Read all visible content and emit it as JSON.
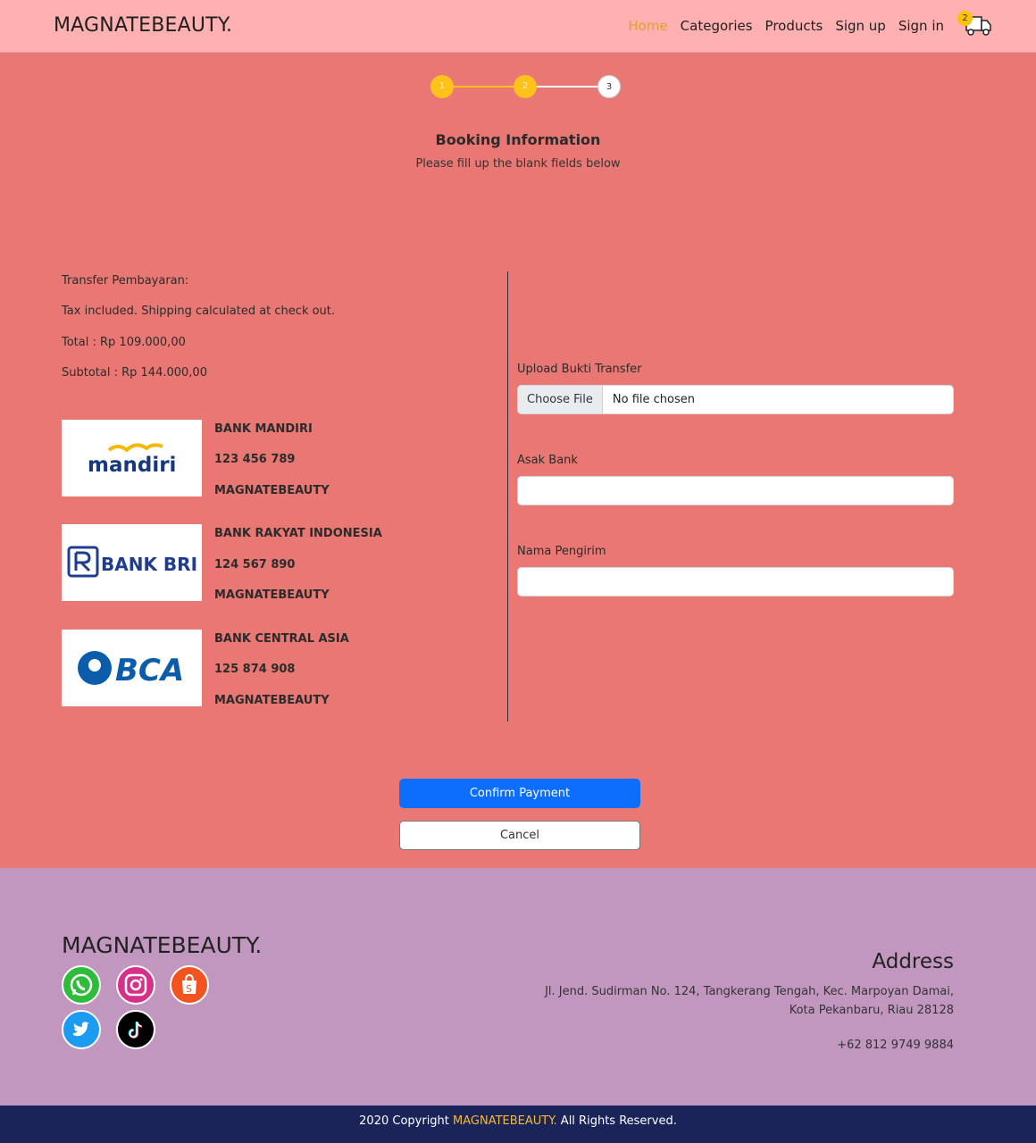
{
  "nav": {
    "brand": "MAGNATEBEAUTY.",
    "links": [
      "Home",
      "Categories",
      "Products",
      "Sign up",
      "Sign in"
    ],
    "cart_count": "2",
    "active_color": "#e3a02e"
  },
  "stepper": {
    "steps": [
      "1",
      "2",
      "3"
    ],
    "active_color": "#ffc21a"
  },
  "heading": {
    "title": "Booking Information",
    "subtitle": "Please fill up the blank fields below"
  },
  "payment": {
    "transfer_label": "Transfer Pembayaran:",
    "tax_note": "Tax included. Shipping calculated at check out.",
    "total": "Total : Rp 109.000,00",
    "subtotal": "Subtotal : Rp 144.000,00"
  },
  "banks": [
    {
      "logo_text": "mandiri",
      "name": "BANK MANDIRI",
      "account": "123 456 789",
      "holder": "MAGNATEBEAUTY"
    },
    {
      "logo_text": "BANK BRI",
      "name": "BANK RAKYAT INDONESIA",
      "account": "124 567 890",
      "holder": "MAGNATEBEAUTY"
    },
    {
      "logo_text": "BCA",
      "name": "BANK CENTRAL ASIA",
      "account": "125 874 908",
      "holder": "MAGNATEBEAUTY"
    }
  ],
  "form": {
    "upload_label": "Upload Bukti Transfer",
    "choose_file": "Choose File",
    "no_file": "No file chosen",
    "bank_label": "Asak Bank",
    "sender_label": "Nama Pengirim"
  },
  "actions": {
    "confirm": "Confirm Payment",
    "cancel": "Cancel",
    "confirm_color": "#0d6efd"
  },
  "footer": {
    "brand": "MAGNATEBEAUTY.",
    "social_icons": [
      "whatsapp-icon",
      "instagram-icon",
      "shopee-icon",
      "twitter-icon",
      "tiktok-icon"
    ],
    "address_title": "Address",
    "address": "Jl. Jend. Sudirman No. 124, Tangkerang Tengah, Kec. Marpoyan Damai, Kota Pekanbaru, Riau 28128",
    "phone": "+62 812 9749 9884",
    "copyright_prefix": "2020 Copyright ",
    "copyright_brand": "MAGNATEBEAUTY.",
    "copyright_suffix": " All Rights Reserved."
  },
  "colors": {
    "nav_bg": "#ffb0b0",
    "page_bg": "#e97874",
    "footer_bg": "#c197c0",
    "bottom_bar_bg": "#1b2458"
  }
}
